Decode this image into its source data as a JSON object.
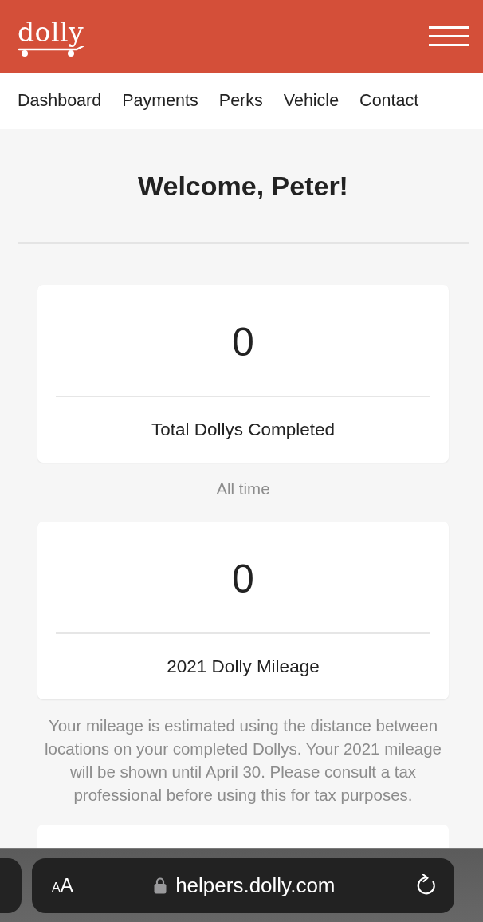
{
  "header": {
    "logo": "dolly"
  },
  "nav": {
    "items": [
      {
        "label": "Dashboard"
      },
      {
        "label": "Payments"
      },
      {
        "label": "Perks"
      },
      {
        "label": "Vehicle"
      },
      {
        "label": "Contact"
      }
    ]
  },
  "welcome": "Welcome, Peter!",
  "stats": [
    {
      "value": "0",
      "label": "Total Dollys Completed",
      "caption": "All time"
    },
    {
      "value": "0",
      "label": "2021 Dolly Mileage",
      "caption": "Your mileage is estimated using the distance between locations on your completed Dollys. Your 2021 mileage will be shown until April 30. Please consult a tax professional before using this for tax purposes."
    }
  ],
  "browser_bar": {
    "text_size_button": {
      "small": "A",
      "large": "A"
    },
    "url": "helpers.dolly.com"
  }
}
